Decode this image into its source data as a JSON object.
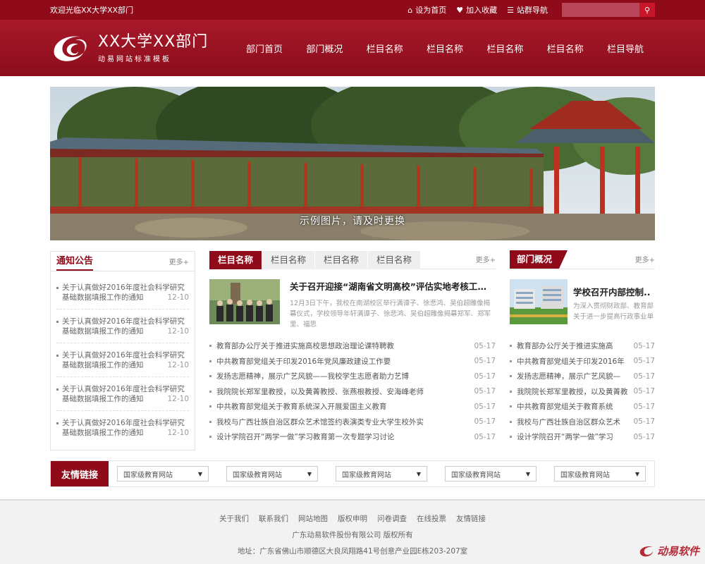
{
  "topbar": {
    "welcome": "欢迎光临XX大学XX部门",
    "set_home": "设为首页",
    "add_fav": "加入收藏",
    "site_nav": "站群导航",
    "search_placeholder": ""
  },
  "header": {
    "logo_title": "XX大学XX部门",
    "logo_sub": "动易网站标准模板",
    "nav": [
      "部门首页",
      "部门概况",
      "栏目名称",
      "栏目名称",
      "栏目名称",
      "栏目名称",
      "栏目导航"
    ]
  },
  "banner": {
    "caption": "示例图片，请及时更换"
  },
  "notice": {
    "title": "通知公告",
    "more": "更多+",
    "items": [
      {
        "title": "关于认真做好2016年度社会科学研究基础数据填报工作的通知",
        "date": "12-10"
      },
      {
        "title": "关于认真做好2016年度社会科学研究基础数据填报工作的通知",
        "date": "12-10"
      },
      {
        "title": "关于认真做好2016年度社会科学研究基础数据填报工作的通知",
        "date": "12-10"
      },
      {
        "title": "关于认真做好2016年度社会科学研究基础数据填报工作的通知",
        "date": "12-10"
      },
      {
        "title": "关于认真做好2016年度社会科学研究基础数据填报工作的通知",
        "date": "12-10"
      }
    ]
  },
  "center": {
    "tabs": [
      "栏目名称",
      "栏目名称",
      "栏目名称",
      "栏目名称"
    ],
    "more": "更多+",
    "feature": {
      "title": "关于召开迎接“湖南省文明高校”评估实地考核工作部...",
      "desc": "12月3日下午，我校在南湖校区举行满谭子、徐悲鸿、吴伯超雕像揭幕仪式，学校领导年轩满谭子、徐悲鸿、吴伯超雕像揭幕郑军、郑军里、福思"
    },
    "news": [
      {
        "title": "教育部办公厅关于推进实施高校思想政治理论课特聘教",
        "date": "05-17"
      },
      {
        "title": "中共教育部党组关于印发2016年党风廉政建设工作要",
        "date": "05-17"
      },
      {
        "title": "发扬志愿精神，展示广艺风貌——我校学生志愿者助力艺博",
        "date": "05-17"
      },
      {
        "title": "我院院长郑军里教授，以及黄菁教授、张燕根教授、安海峰老师",
        "date": "05-17"
      },
      {
        "title": "中共教育部党组关于教育系统深入开展爱国主义教育",
        "date": "05-17"
      },
      {
        "title": "我校与广西壮族自治区群众艺术馆签约表演类专业大学生校外实",
        "date": "05-17"
      },
      {
        "title": "设计学院召开“两学一做”学习教育第一次专题学习讨论",
        "date": "05-17"
      }
    ]
  },
  "dept": {
    "title": "部门概况",
    "more": "更多+",
    "feature": {
      "title": "学校召开内部控制...",
      "desc": "为深入贯彻财政部、教育部关于进一步提高行政事业单"
    },
    "news": [
      {
        "title": "教育部办公厅关于推进实施高",
        "date": "05-17"
      },
      {
        "title": "中共教育部党组关于印发2016年",
        "date": "05-17"
      },
      {
        "title": "发扬志愿精神，展示广艺风貌—",
        "date": "05-17"
      },
      {
        "title": "我院院长郑军里教授，以及黄菁教",
        "date": "05-17"
      },
      {
        "title": "中共教育部党组关于教育系统",
        "date": "05-17"
      },
      {
        "title": "我校与广西壮族自治区群众艺术",
        "date": "05-17"
      },
      {
        "title": "设计学院召开“两学一做”学习",
        "date": "05-17"
      }
    ]
  },
  "links": {
    "title": "友情链接",
    "selects": [
      "国家级教育网站",
      "国家级教育网站",
      "国家级教育网站",
      "国家级教育网站",
      "国家级教育网站"
    ]
  },
  "footer": {
    "links": [
      "关于我们",
      "联系我们",
      "网站地图",
      "版权申明",
      "问卷调查",
      "在线投票",
      "友情链接"
    ],
    "copyright": "广东动易软件股份有限公司 版权所有",
    "address": "地址：广东省佛山市顺德区大良凤翔路41号创意产业园E栋203-207室",
    "brand": "动易软件"
  },
  "colors": {
    "primary": "#8f0b1a",
    "header": "#a8192a"
  }
}
